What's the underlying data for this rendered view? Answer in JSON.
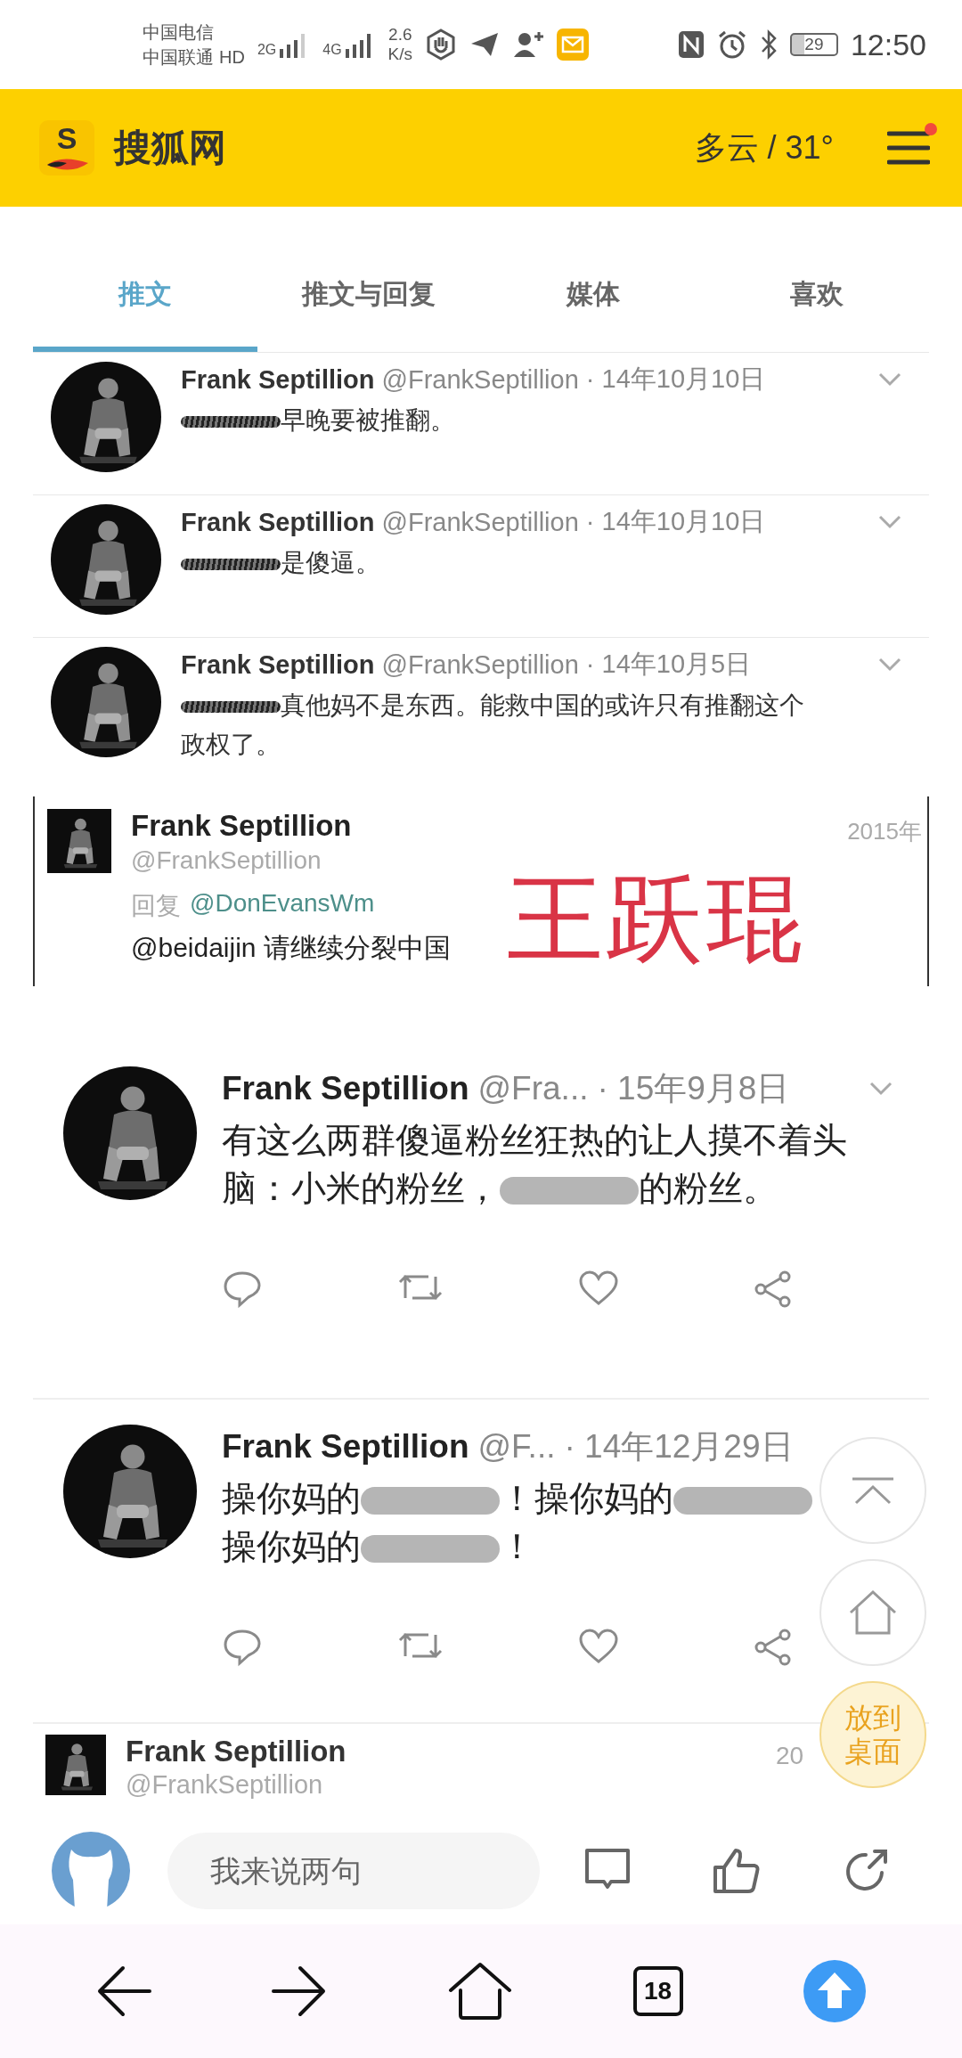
{
  "status_bar": {
    "carriers": [
      "中国电信",
      "中国联通"
    ],
    "hd_badge": "HD",
    "networks": [
      "2G",
      "4G"
    ],
    "speed": [
      "2.6",
      "K/s"
    ],
    "battery": "29",
    "time": "12:50"
  },
  "header": {
    "logo_letter": "S",
    "site": "搜狐网",
    "weather": "多云 / 31°",
    "menu_badge": true
  },
  "profile_shot": {
    "tabs": [
      {
        "label": "推文",
        "selected": true
      },
      {
        "label": "推文与回复",
        "selected": false
      },
      {
        "label": "媒体",
        "selected": false
      },
      {
        "label": "喜欢",
        "selected": false
      }
    ],
    "tweets": [
      {
        "name": "Frank Septillion",
        "handle": "@FrankSeptillion",
        "date": "· 14年10月10日",
        "lines": [
          [
            {
              "kind": "redacted"
            },
            {
              "kind": "text",
              "text": "早晚要被推翻。"
            }
          ]
        ]
      },
      {
        "name": "Frank Septillion",
        "handle": "@FrankSeptillion",
        "date": "· 14年10月10日",
        "lines": [
          [
            {
              "kind": "redacted"
            },
            {
              "kind": "text",
              "text": "是傻逼。"
            }
          ]
        ]
      },
      {
        "name": "Frank Septillion",
        "handle": "@FrankSeptillion",
        "date": "· 14年10月5日",
        "lines": [
          [
            {
              "kind": "redacted"
            },
            {
              "kind": "text",
              "text": "真他妈不是东西。能救中国的或许只有推翻这个"
            }
          ],
          [
            {
              "kind": "text",
              "text": "政权了。"
            }
          ]
        ]
      }
    ]
  },
  "reply_card": {
    "name": "Frank Septillion",
    "handle": "@FrankSeptillion",
    "date": "2015年",
    "reply_label": "回复",
    "reply_to": "@DonEvansWm",
    "text": "@beidaijin 请继续分裂中国",
    "overlay": "王跃琨"
  },
  "tweet_cards": [
    {
      "name": "Frank Septillion",
      "handle": "@Fra...",
      "date": "· 15年9月8日",
      "lines": [
        [
          {
            "kind": "text",
            "text": "有这么两群傻逼粉丝狂热的让人摸不着头"
          }
        ],
        [
          {
            "kind": "text",
            "text": "脑：小米的粉丝，"
          },
          {
            "kind": "redacted"
          },
          {
            "kind": "text",
            "text": "的粉丝。"
          }
        ]
      ]
    },
    {
      "name": "Frank Septillion",
      "handle": "@F...",
      "date": "· 14年12月29日",
      "lines": [
        [
          {
            "kind": "text",
            "text": "操你妈的"
          },
          {
            "kind": "redacted"
          },
          {
            "kind": "text",
            "text": "！操你妈的"
          },
          {
            "kind": "redacted"
          }
        ],
        [
          {
            "kind": "text",
            "text": "操你妈的"
          },
          {
            "kind": "redacted"
          },
          {
            "kind": "text",
            "text": "！"
          }
        ]
      ]
    }
  ],
  "last_card": {
    "name": "Frank Septillion",
    "handle": "@FrankSeptillion",
    "date": "20"
  },
  "float_buttons": [
    {
      "kind": "top"
    },
    {
      "kind": "home"
    },
    {
      "kind": "desktop",
      "label": "放到桌面"
    }
  ],
  "comment_bar": {
    "placeholder": "我来说两句"
  },
  "nav_bar": {
    "tab_count": "18"
  }
}
